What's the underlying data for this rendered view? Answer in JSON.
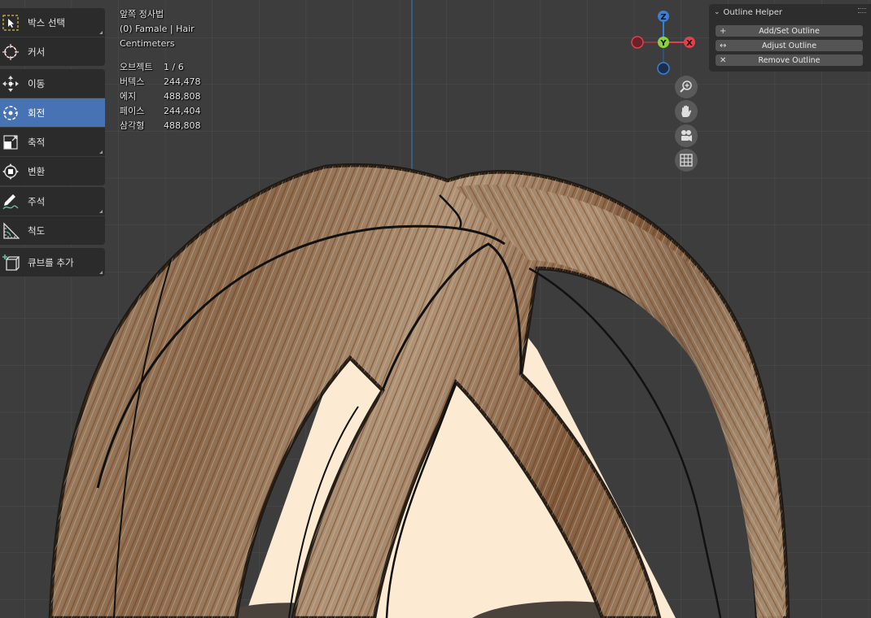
{
  "toolbar": {
    "groups": [
      [
        {
          "label": "박스 선택",
          "icon": "select-box-icon",
          "has_submenu": true
        },
        {
          "label": "커서",
          "icon": "cursor-icon",
          "has_submenu": false
        }
      ],
      [
        {
          "label": "이동",
          "icon": "move-icon",
          "has_submenu": false
        },
        {
          "label": "회전",
          "icon": "rotate-icon",
          "has_submenu": false,
          "active": true
        },
        {
          "label": "축적",
          "icon": "scale-icon",
          "has_submenu": true
        },
        {
          "label": "변환",
          "icon": "transform-icon",
          "has_submenu": false
        }
      ],
      [
        {
          "label": "주석",
          "icon": "annotate-icon",
          "has_submenu": true
        },
        {
          "label": "척도",
          "icon": "measure-icon",
          "has_submenu": false
        }
      ],
      [
        {
          "label": "큐브를 추가",
          "icon": "add-cube-icon",
          "has_submenu": true
        }
      ]
    ]
  },
  "viewport_info": {
    "view_name": "앞쪽 정사법",
    "object_name": "(0) Famale | Hair",
    "units": "Centimeters",
    "stats": [
      {
        "label": "오브젝트",
        "value": "1 / 6"
      },
      {
        "label": "버텍스",
        "value": "244,478"
      },
      {
        "label": "에지",
        "value": "488,808"
      },
      {
        "label": "페이스",
        "value": "244,404"
      },
      {
        "label": "삼각형",
        "value": "488,808"
      }
    ]
  },
  "gizmo": {
    "z": "Z",
    "y": "Y",
    "x": "X",
    "colors": {
      "x": "#e0424c",
      "y": "#8ad13f",
      "z": "#3b7fd4"
    }
  },
  "nav_buttons": [
    "zoom-icon",
    "hand-pan-icon",
    "camera-icon",
    "grid-icon"
  ],
  "outline_panel": {
    "title": "Outline Helper",
    "buttons": [
      {
        "label": "Add/Set Outline",
        "icon": "+"
      },
      {
        "label": "Adjust Outline",
        "icon": "↔"
      },
      {
        "label": "Remove Outline",
        "icon": "✕"
      }
    ]
  },
  "colors": {
    "accent": "#4772b3",
    "viewport_bg": "#3d3d3d",
    "grid": "#4a4a4a",
    "selection_outline": "#f08a24",
    "skin": "#fcebd2"
  }
}
